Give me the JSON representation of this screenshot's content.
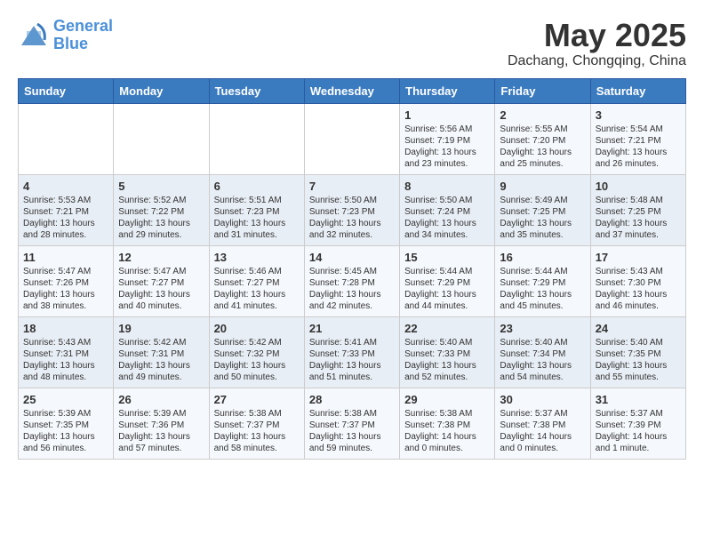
{
  "header": {
    "logo_line1": "General",
    "logo_line2": "Blue",
    "month_year": "May 2025",
    "location": "Dachang, Chongqing, China"
  },
  "days_of_week": [
    "Sunday",
    "Monday",
    "Tuesday",
    "Wednesday",
    "Thursday",
    "Friday",
    "Saturday"
  ],
  "weeks": [
    [
      {
        "day": "",
        "info": ""
      },
      {
        "day": "",
        "info": ""
      },
      {
        "day": "",
        "info": ""
      },
      {
        "day": "",
        "info": ""
      },
      {
        "day": "1",
        "info": "Sunrise: 5:56 AM\nSunset: 7:19 PM\nDaylight: 13 hours\nand 23 minutes."
      },
      {
        "day": "2",
        "info": "Sunrise: 5:55 AM\nSunset: 7:20 PM\nDaylight: 13 hours\nand 25 minutes."
      },
      {
        "day": "3",
        "info": "Sunrise: 5:54 AM\nSunset: 7:21 PM\nDaylight: 13 hours\nand 26 minutes."
      }
    ],
    [
      {
        "day": "4",
        "info": "Sunrise: 5:53 AM\nSunset: 7:21 PM\nDaylight: 13 hours\nand 28 minutes."
      },
      {
        "day": "5",
        "info": "Sunrise: 5:52 AM\nSunset: 7:22 PM\nDaylight: 13 hours\nand 29 minutes."
      },
      {
        "day": "6",
        "info": "Sunrise: 5:51 AM\nSunset: 7:23 PM\nDaylight: 13 hours\nand 31 minutes."
      },
      {
        "day": "7",
        "info": "Sunrise: 5:50 AM\nSunset: 7:23 PM\nDaylight: 13 hours\nand 32 minutes."
      },
      {
        "day": "8",
        "info": "Sunrise: 5:50 AM\nSunset: 7:24 PM\nDaylight: 13 hours\nand 34 minutes."
      },
      {
        "day": "9",
        "info": "Sunrise: 5:49 AM\nSunset: 7:25 PM\nDaylight: 13 hours\nand 35 minutes."
      },
      {
        "day": "10",
        "info": "Sunrise: 5:48 AM\nSunset: 7:25 PM\nDaylight: 13 hours\nand 37 minutes."
      }
    ],
    [
      {
        "day": "11",
        "info": "Sunrise: 5:47 AM\nSunset: 7:26 PM\nDaylight: 13 hours\nand 38 minutes."
      },
      {
        "day": "12",
        "info": "Sunrise: 5:47 AM\nSunset: 7:27 PM\nDaylight: 13 hours\nand 40 minutes."
      },
      {
        "day": "13",
        "info": "Sunrise: 5:46 AM\nSunset: 7:27 PM\nDaylight: 13 hours\nand 41 minutes."
      },
      {
        "day": "14",
        "info": "Sunrise: 5:45 AM\nSunset: 7:28 PM\nDaylight: 13 hours\nand 42 minutes."
      },
      {
        "day": "15",
        "info": "Sunrise: 5:44 AM\nSunset: 7:29 PM\nDaylight: 13 hours\nand 44 minutes."
      },
      {
        "day": "16",
        "info": "Sunrise: 5:44 AM\nSunset: 7:29 PM\nDaylight: 13 hours\nand 45 minutes."
      },
      {
        "day": "17",
        "info": "Sunrise: 5:43 AM\nSunset: 7:30 PM\nDaylight: 13 hours\nand 46 minutes."
      }
    ],
    [
      {
        "day": "18",
        "info": "Sunrise: 5:43 AM\nSunset: 7:31 PM\nDaylight: 13 hours\nand 48 minutes."
      },
      {
        "day": "19",
        "info": "Sunrise: 5:42 AM\nSunset: 7:31 PM\nDaylight: 13 hours\nand 49 minutes."
      },
      {
        "day": "20",
        "info": "Sunrise: 5:42 AM\nSunset: 7:32 PM\nDaylight: 13 hours\nand 50 minutes."
      },
      {
        "day": "21",
        "info": "Sunrise: 5:41 AM\nSunset: 7:33 PM\nDaylight: 13 hours\nand 51 minutes."
      },
      {
        "day": "22",
        "info": "Sunrise: 5:40 AM\nSunset: 7:33 PM\nDaylight: 13 hours\nand 52 minutes."
      },
      {
        "day": "23",
        "info": "Sunrise: 5:40 AM\nSunset: 7:34 PM\nDaylight: 13 hours\nand 54 minutes."
      },
      {
        "day": "24",
        "info": "Sunrise: 5:40 AM\nSunset: 7:35 PM\nDaylight: 13 hours\nand 55 minutes."
      }
    ],
    [
      {
        "day": "25",
        "info": "Sunrise: 5:39 AM\nSunset: 7:35 PM\nDaylight: 13 hours\nand 56 minutes."
      },
      {
        "day": "26",
        "info": "Sunrise: 5:39 AM\nSunset: 7:36 PM\nDaylight: 13 hours\nand 57 minutes."
      },
      {
        "day": "27",
        "info": "Sunrise: 5:38 AM\nSunset: 7:37 PM\nDaylight: 13 hours\nand 58 minutes."
      },
      {
        "day": "28",
        "info": "Sunrise: 5:38 AM\nSunset: 7:37 PM\nDaylight: 13 hours\nand 59 minutes."
      },
      {
        "day": "29",
        "info": "Sunrise: 5:38 AM\nSunset: 7:38 PM\nDaylight: 14 hours\nand 0 minutes."
      },
      {
        "day": "30",
        "info": "Sunrise: 5:37 AM\nSunset: 7:38 PM\nDaylight: 14 hours\nand 0 minutes."
      },
      {
        "day": "31",
        "info": "Sunrise: 5:37 AM\nSunset: 7:39 PM\nDaylight: 14 hours\nand 1 minute."
      }
    ]
  ]
}
